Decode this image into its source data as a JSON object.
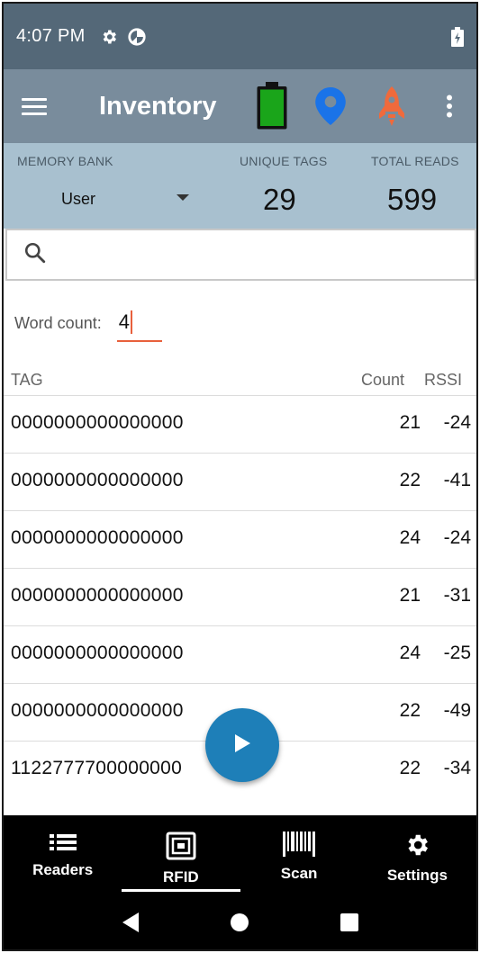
{
  "status_bar": {
    "time": "4:07 PM",
    "icons": [
      "gear-icon",
      "data-saver-icon"
    ],
    "right_icons": [
      "battery-charging-icon"
    ]
  },
  "app_bar": {
    "title": "Inventory",
    "actions": [
      "battery-full-icon",
      "location-pin-icon",
      "rocket-icon",
      "more-vert-icon"
    ]
  },
  "colors": {
    "status_bar": "#546878",
    "app_bar": "#798c9c",
    "stats_panel": "#a8c0cf",
    "battery_fill": "#1aa51a",
    "location_pin": "#1a73e8",
    "rocket": "#ef6a3c",
    "fab": "#1e7fb8",
    "accent_underline": "#e8603c"
  },
  "stats": {
    "memory_bank_label": "MEMORY BANK",
    "memory_bank_value": "User",
    "unique_tags_label": "UNIQUE TAGS",
    "unique_tags_value": "29",
    "total_reads_label": "TOTAL READS",
    "total_reads_value": "599"
  },
  "search": {
    "placeholder": "",
    "value": ""
  },
  "word_count": {
    "label": "Word count:",
    "value": "4"
  },
  "table": {
    "headers": {
      "tag": "TAG",
      "count": "Count",
      "rssi": "RSSI"
    },
    "rows": [
      {
        "tag": "0000000000000000",
        "count": "21",
        "rssi": "-24"
      },
      {
        "tag": "0000000000000000",
        "count": "22",
        "rssi": "-41"
      },
      {
        "tag": "0000000000000000",
        "count": "24",
        "rssi": "-24"
      },
      {
        "tag": "0000000000000000",
        "count": "21",
        "rssi": "-31"
      },
      {
        "tag": "0000000000000000",
        "count": "24",
        "rssi": "-25"
      },
      {
        "tag": "0000000000000000",
        "count": "22",
        "rssi": "-49"
      },
      {
        "tag": "1122777700000000",
        "count": "22",
        "rssi": "-34"
      }
    ]
  },
  "fab": {
    "icon": "play-icon"
  },
  "bottom_nav": {
    "items": [
      {
        "label": "Readers",
        "icon": "list-icon"
      },
      {
        "label": "RFID",
        "icon": "rfid-icon",
        "active": true
      },
      {
        "label": "Scan",
        "icon": "barcode-icon"
      },
      {
        "label": "Settings",
        "icon": "gear-icon"
      }
    ]
  },
  "system_nav": [
    "back-icon",
    "home-icon",
    "recents-icon"
  ]
}
